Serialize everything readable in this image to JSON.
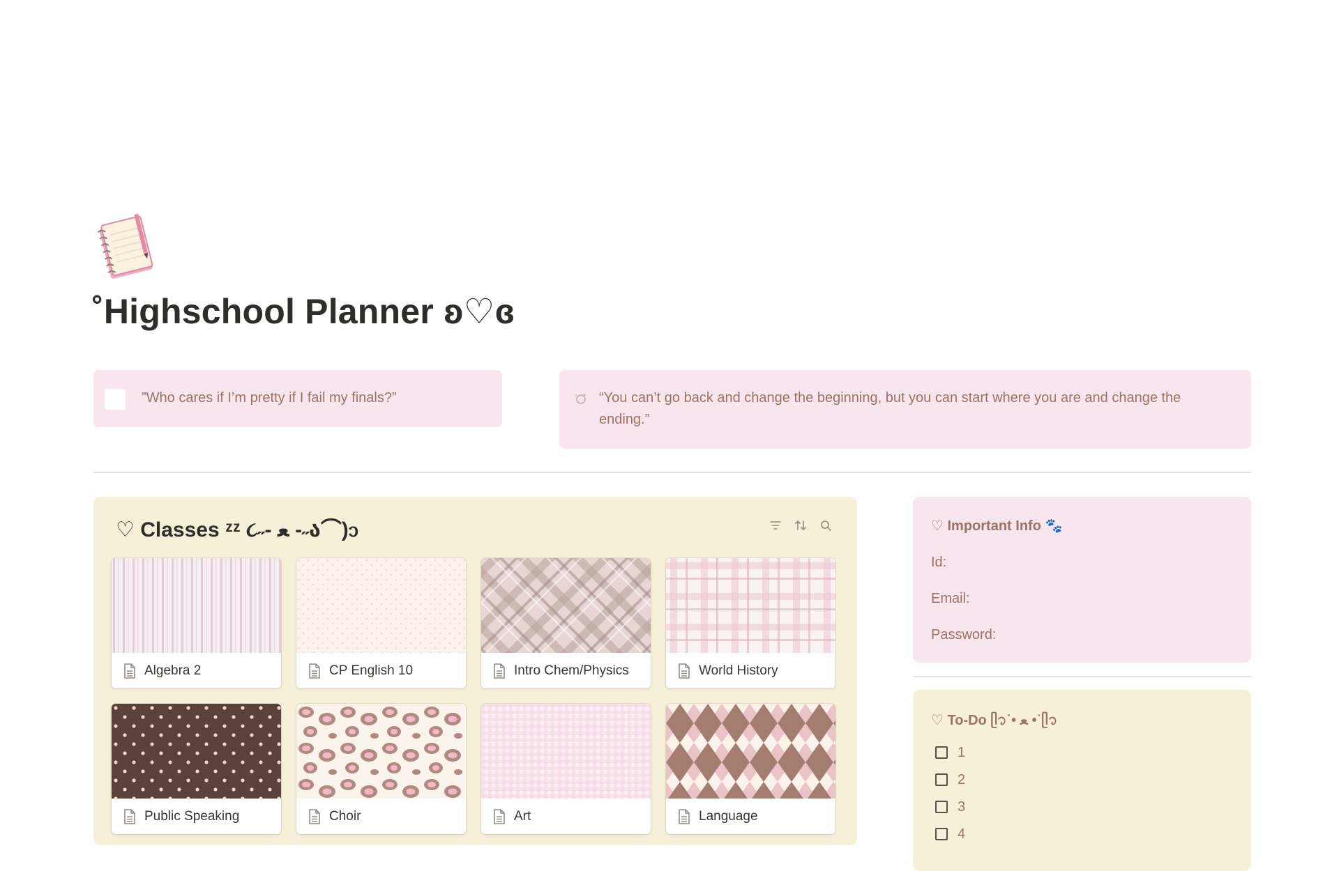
{
  "page": {
    "icon": "notebook-icon",
    "title": "˚Highschool Planner ʚ♡ɞ"
  },
  "callouts": [
    {
      "icon": "checkbox-blank",
      "text": "”Who cares if I’m pretty if I fail my finals?”"
    },
    {
      "icon": "sparkle-icon",
      "text": "“You can’t go back and change the beginning, but you can start where you are and change the ending.”"
    }
  ],
  "classes": {
    "title": "♡ Classes  ᶻᶻ ૮˶- ﻌ -˶ა⌒)ᦱ",
    "tools": [
      "filter-icon",
      "sort-icon",
      "search-icon"
    ],
    "cards": [
      {
        "name": "Algebra 2",
        "pattern": "stripes"
      },
      {
        "name": "CP English 10",
        "pattern": "dots-light"
      },
      {
        "name": "Intro Chem/Physics",
        "pattern": "plaid-brown"
      },
      {
        "name": "World History",
        "pattern": "plaid-pink"
      },
      {
        "name": "Public Speaking",
        "pattern": "polka-brown"
      },
      {
        "name": "Choir",
        "pattern": "leopard"
      },
      {
        "name": "Art",
        "pattern": "gingham"
      },
      {
        "name": "Language",
        "pattern": "argyle"
      }
    ]
  },
  "info": {
    "title": "♡ Important Info 🐾",
    "lines": [
      "Id:",
      "Email:",
      "Password:"
    ]
  },
  "todo": {
    "title": "♡ To-Do  ᥫ᭡˙• ﻌ •˙ᥫ᭡",
    "items": [
      "1",
      "2",
      "3",
      "4"
    ]
  },
  "colors": {
    "callout_bg": "#f8e5ee",
    "classes_bg": "#f7f0d9",
    "accent_text": "#9a7463"
  }
}
